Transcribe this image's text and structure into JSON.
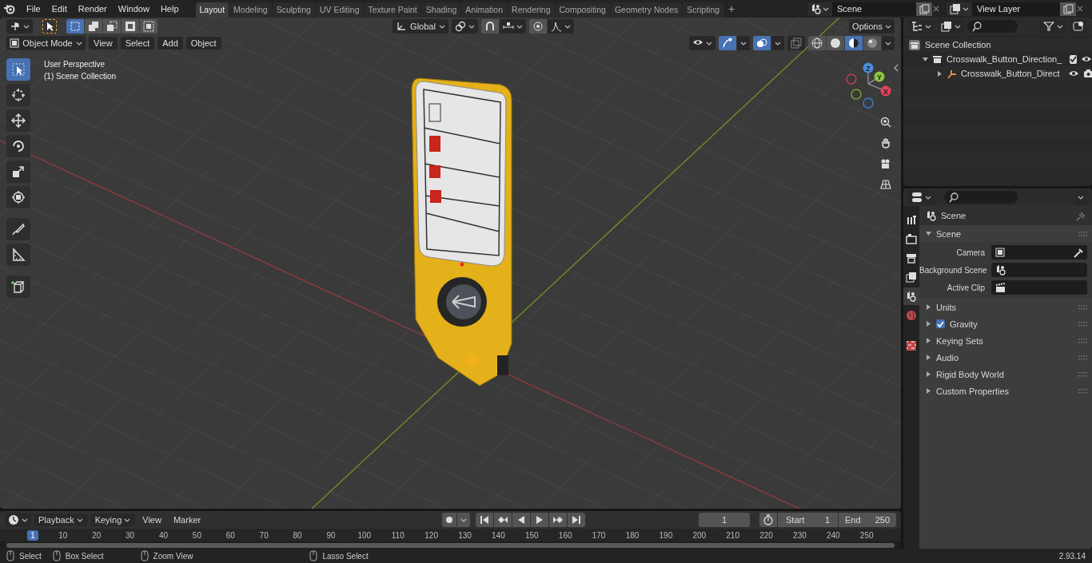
{
  "top_bar": {
    "menus": [
      "File",
      "Edit",
      "Render",
      "Window",
      "Help"
    ],
    "workspaces": [
      {
        "label": "Layout",
        "selected": true
      },
      {
        "label": "Modeling",
        "selected": false
      },
      {
        "label": "Sculpting",
        "selected": false
      },
      {
        "label": "UV Editing",
        "selected": false
      },
      {
        "label": "Texture Paint",
        "selected": false
      },
      {
        "label": "Shading",
        "selected": false
      },
      {
        "label": "Animation",
        "selected": false
      },
      {
        "label": "Rendering",
        "selected": false
      },
      {
        "label": "Compositing",
        "selected": false
      },
      {
        "label": "Geometry Nodes",
        "selected": false
      },
      {
        "label": "Scripting",
        "selected": false
      }
    ],
    "add_workspace": "+",
    "scene": "Scene",
    "view_layer": "View Layer"
  },
  "viewport": {
    "select_modes": [
      {
        "selected": true
      },
      {
        "selected": false
      },
      {
        "selected": false
      },
      {
        "selected": false
      },
      {
        "selected": false
      }
    ],
    "orientation": "Global",
    "options": "Options",
    "mode": "Object Mode",
    "menus": [
      "View",
      "Select",
      "Add",
      "Object"
    ],
    "shading": [
      {
        "selected": false
      },
      {
        "selected": false
      },
      {
        "selected": true
      },
      {
        "selected": false
      }
    ],
    "info": [
      "User Perspective",
      "(1) Scene Collection"
    ],
    "tools": [
      {
        "selected": true
      },
      {
        "selected": false
      },
      {
        "selected": false
      },
      {
        "selected": false
      },
      {
        "selected": false
      },
      {
        "selected": false
      },
      {
        "selected": false
      },
      {
        "selected": false
      },
      {
        "selected": false
      }
    ],
    "gizmo_axes": [
      "X",
      "Y",
      "Z"
    ]
  },
  "outliner": {
    "items": [
      {
        "label": "Scene Collection",
        "kind": "scene_collection",
        "children": [
          {
            "label": "Crosswalk_Button_Direction_",
            "kind": "collection",
            "expanded": true,
            "checked": true,
            "children": [
              {
                "label": "Crosswalk_Button_Direct",
                "kind": "object",
                "expanded": false
              }
            ]
          }
        ]
      }
    ]
  },
  "properties": {
    "tabs": [
      {
        "selected": false
      },
      {
        "selected": false
      },
      {
        "selected": false
      },
      {
        "selected": false
      },
      {
        "selected": true
      },
      {
        "selected": false
      },
      {
        "selected": false
      }
    ],
    "context": "Scene",
    "panels": [
      {
        "title": "Scene",
        "kind": "plain",
        "expanded": true,
        "fields": [
          {
            "label": "Camera"
          },
          {
            "label": "Background Scene"
          },
          {
            "label": "Active Clip"
          }
        ]
      },
      {
        "title": "Units",
        "kind": "plain",
        "expanded": false
      },
      {
        "title": "Gravity",
        "kind": "checkbox",
        "expanded": false,
        "checked": true
      },
      {
        "title": "Keying Sets",
        "kind": "plain",
        "expanded": false
      },
      {
        "title": "Audio",
        "kind": "plain",
        "expanded": false
      },
      {
        "title": "Rigid Body World",
        "kind": "plain",
        "expanded": false
      },
      {
        "title": "Custom Properties",
        "kind": "plain",
        "expanded": false
      }
    ]
  },
  "timeline": {
    "dropdowns": [
      "Playback",
      "Keying"
    ],
    "menus": [
      "View",
      "Marker"
    ],
    "current_frame": "1",
    "start_label": "Start",
    "start": "1",
    "end_label": "End",
    "end": "250",
    "ruler": [
      {
        "label": "1",
        "selected": true
      },
      {
        "label": "10",
        "selected": false
      },
      {
        "label": "20",
        "selected": false
      },
      {
        "label": "30",
        "selected": false
      },
      {
        "label": "40",
        "selected": false
      },
      {
        "label": "50",
        "selected": false
      },
      {
        "label": "60",
        "selected": false
      },
      {
        "label": "70",
        "selected": false
      },
      {
        "label": "80",
        "selected": false
      },
      {
        "label": "90",
        "selected": false
      },
      {
        "label": "100",
        "selected": false
      },
      {
        "label": "110",
        "selected": false
      },
      {
        "label": "120",
        "selected": false
      },
      {
        "label": "130",
        "selected": false
      },
      {
        "label": "140",
        "selected": false
      },
      {
        "label": "150",
        "selected": false
      },
      {
        "label": "160",
        "selected": false
      },
      {
        "label": "170",
        "selected": false
      },
      {
        "label": "180",
        "selected": false
      },
      {
        "label": "190",
        "selected": false
      },
      {
        "label": "200",
        "selected": false
      },
      {
        "label": "210",
        "selected": false
      },
      {
        "label": "220",
        "selected": false
      },
      {
        "label": "230",
        "selected": false
      },
      {
        "label": "240",
        "selected": false
      },
      {
        "label": "250",
        "selected": false
      }
    ]
  },
  "status_bar": {
    "hints": [
      "Select",
      "Box Select",
      "Zoom View",
      "Lasso Select"
    ],
    "version": "2.93.14"
  }
}
